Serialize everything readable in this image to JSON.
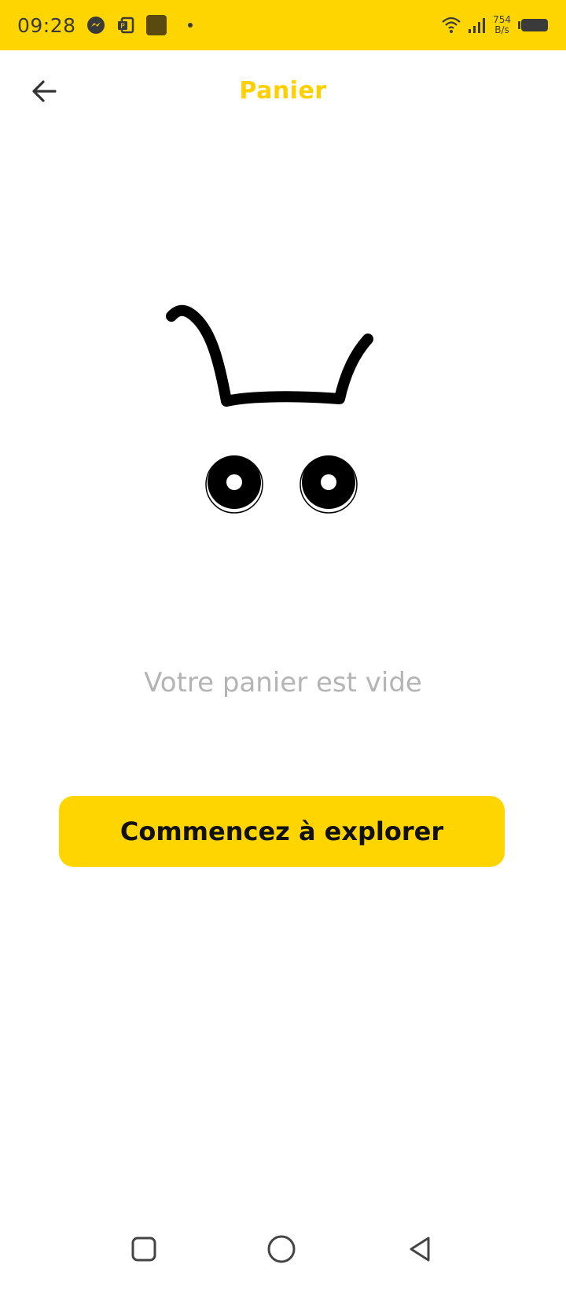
{
  "status_bar": {
    "time": "09:28",
    "network_speed_value": "754",
    "network_speed_unit": "B/s",
    "icons": [
      "messenger-icon",
      "office-icon",
      "app-square-icon",
      "notification-dot",
      "wifi-icon",
      "signal-icon",
      "battery-icon"
    ]
  },
  "header": {
    "title": "Panier",
    "back_icon": "arrow-left-icon"
  },
  "empty_state": {
    "illustration": "empty-cart-icon",
    "message": "Votre panier est vide"
  },
  "cta": {
    "label": "Commencez à explorer"
  },
  "nav_bar": {
    "icons": [
      "recents-square-icon",
      "home-circle-icon",
      "back-triangle-icon"
    ]
  },
  "colors": {
    "accent": "#FFD500",
    "title": "#FFD000",
    "muted_text": "#b4b4b4",
    "ink": "#111111"
  }
}
